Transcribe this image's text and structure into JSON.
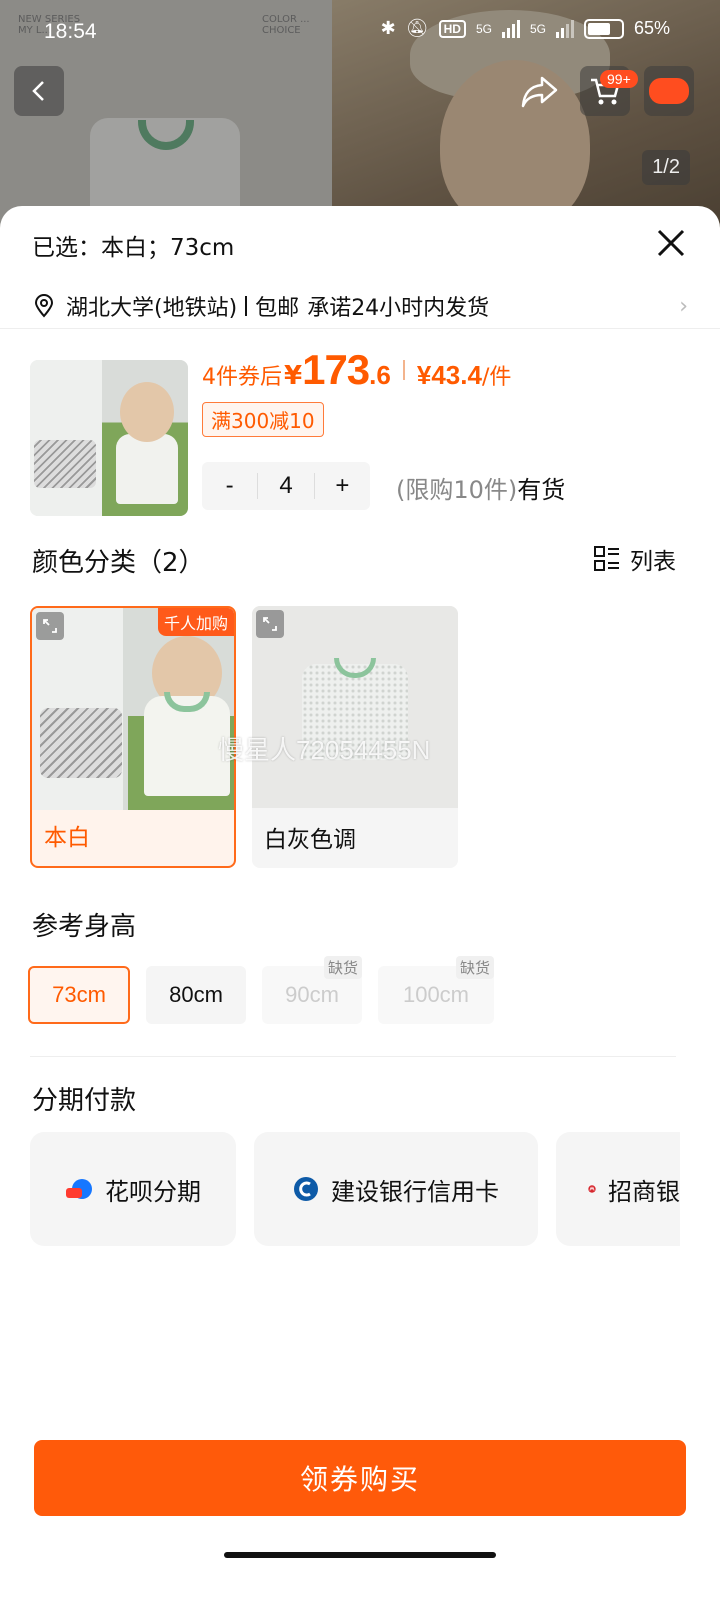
{
  "status_bar": {
    "time": "18:54",
    "battery": "65%",
    "network_1": "5G",
    "network_2": "5G",
    "hd": "HD"
  },
  "header": {
    "cart_badge": "99+",
    "image_counter": "1/2",
    "bg_tag_left": "NEW SERIES\nMY L...",
    "bg_tag_right": "COLOR ...\nCHOICE"
  },
  "sheet": {
    "selected": "已选：本白；73cm",
    "address": "湖北大学(地铁站)",
    "shipping_free": "包邮",
    "shipping_promise": "承诺24小时内发货",
    "price_prefix": "4件券后",
    "price_yen": "¥",
    "price_int": "173",
    "price_dec": ".6",
    "unit_price": "¥43.4",
    "unit_label": "/件",
    "coupon": "满300减10",
    "qty_minus": "-",
    "qty_value": "4",
    "qty_plus": "+",
    "limit_text": "(限购10件)",
    "stock": "有货"
  },
  "color_section": {
    "title": "颜色分类（2）",
    "list_label": "列表",
    "options": [
      {
        "label": "本白",
        "tag": "千人加购",
        "selected": true
      },
      {
        "label": "白灰色调",
        "selected": false
      }
    ],
    "watermark": "慢星人72054455N"
  },
  "size_section": {
    "title": "参考身高",
    "options": [
      {
        "label": "73cm",
        "selected": true,
        "out_of_stock": false
      },
      {
        "label": "80cm",
        "selected": false,
        "out_of_stock": false
      },
      {
        "label": "90cm",
        "selected": false,
        "out_of_stock": true,
        "oos_label": "缺货"
      },
      {
        "label": "100cm",
        "selected": false,
        "out_of_stock": true,
        "oos_label": "缺货"
      }
    ]
  },
  "installment": {
    "title": "分期付款",
    "options": [
      {
        "label": "花呗分期",
        "icon": "huabei-icon"
      },
      {
        "label": "建设银行信用卡",
        "icon": "ccb-icon"
      },
      {
        "label": "招商银",
        "icon": "cmb-icon"
      }
    ]
  },
  "buy_button": "领券购买",
  "colors": {
    "accent": "#ff5a0a",
    "accent_text": "#ff5a00"
  }
}
